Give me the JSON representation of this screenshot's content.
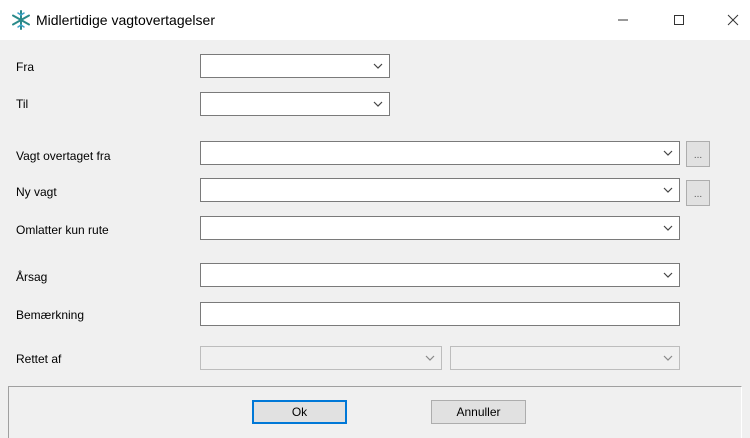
{
  "window": {
    "title": "Midlertidige vagtovertagelser",
    "minimize_icon": "minimize-icon",
    "maximize_icon": "maximize-icon",
    "close_icon": "close-icon",
    "app_icon": "snowflake-app-icon"
  },
  "form": {
    "fra": {
      "label": "Fra",
      "value": ""
    },
    "til": {
      "label": "Til",
      "value": ""
    },
    "vagt_overtaget_fra": {
      "label": "Vagt overtaget fra",
      "value": "",
      "browse_label": "..."
    },
    "ny_vagt": {
      "label": "Ny vagt",
      "value": "",
      "browse_label": "..."
    },
    "omlaegger_kun_rute": {
      "label": "Omlatter kun rute",
      "value": ""
    },
    "aarsag": {
      "label": "Årsag",
      "value": ""
    },
    "bemaerkning": {
      "label": "Bemærkning",
      "value": ""
    },
    "rettet_af": {
      "label": "Rettet af",
      "value_1": "",
      "value_2": ""
    }
  },
  "buttons": {
    "ok": "Ok",
    "cancel": "Annuller"
  },
  "colors": {
    "accent": "#0078d7",
    "icon": "#2a8a8a"
  }
}
